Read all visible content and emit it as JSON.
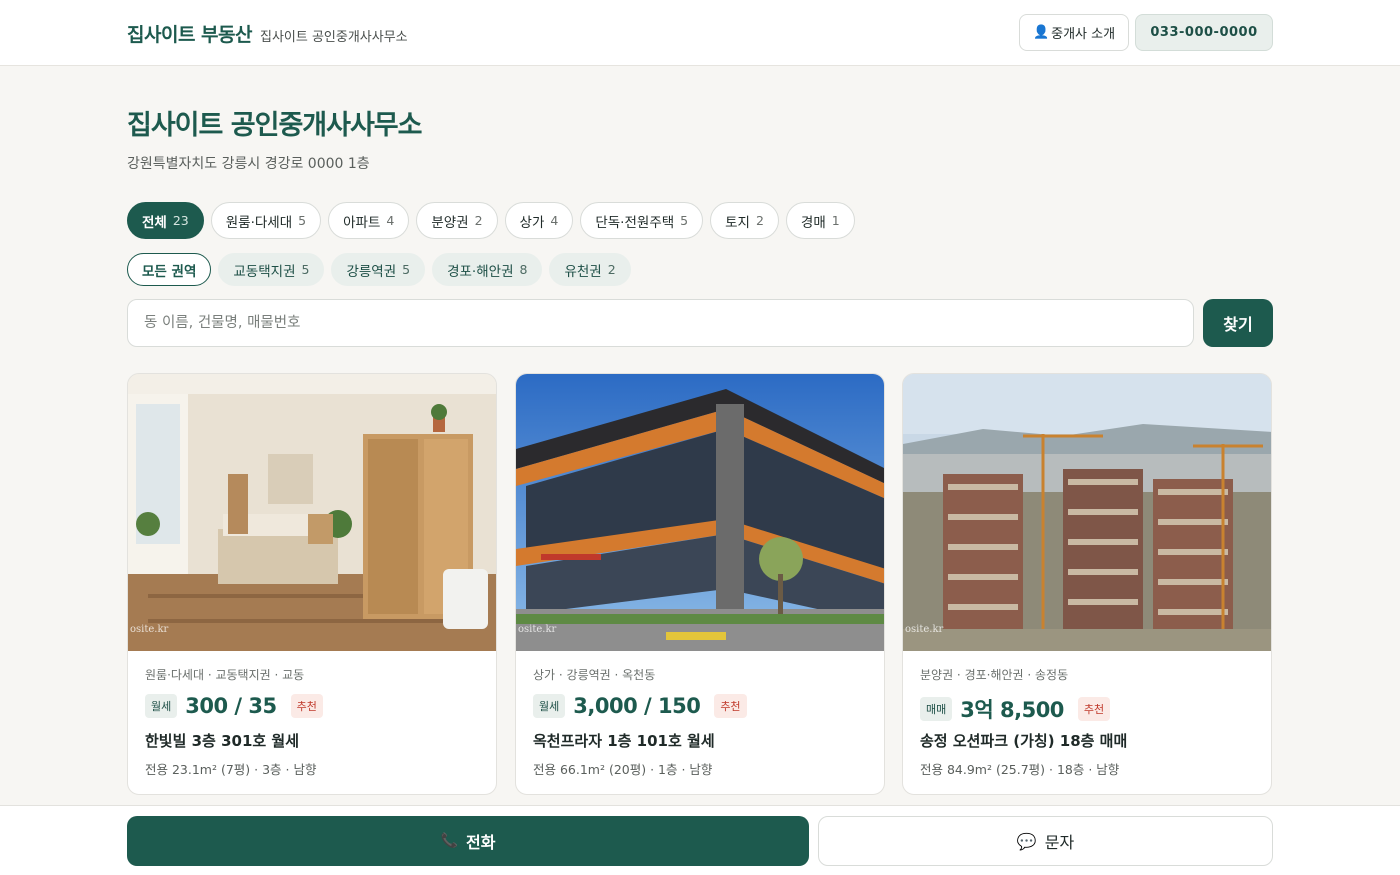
{
  "header": {
    "brand_name": "집사이트 부동산",
    "brand_sub": "집사이트 공인중개사사무소",
    "intro_button": "중개사 소개",
    "intro_icon": "person-icon",
    "phone_button": "033-000-0000"
  },
  "office": {
    "title": "집사이트 공인중개사사무소",
    "address": "강원특별자치도 강릉시 경강로 0000 1층"
  },
  "categories": [
    {
      "label": "전체",
      "count": "23",
      "active": true
    },
    {
      "label": "원룸·다세대",
      "count": "5"
    },
    {
      "label": "아파트",
      "count": "4"
    },
    {
      "label": "분양권",
      "count": "2"
    },
    {
      "label": "상가",
      "count": "4"
    },
    {
      "label": "단독·전원주택",
      "count": "5"
    },
    {
      "label": "토지",
      "count": "2"
    },
    {
      "label": "경매",
      "count": "1"
    }
  ],
  "regions": [
    {
      "label": "모든 권역",
      "count": "",
      "active": true
    },
    {
      "label": "교동택지권",
      "count": "5"
    },
    {
      "label": "강릉역권",
      "count": "5"
    },
    {
      "label": "경포·해안권",
      "count": "8"
    },
    {
      "label": "유천권",
      "count": "2"
    }
  ],
  "search": {
    "placeholder": "동 이름, 건물명, 매물번호",
    "button": "찾기"
  },
  "listings": [
    {
      "meta": "원룸·다세대 · 교동택지권 · 교동",
      "deal": "월세",
      "price": "300 / 35",
      "badge": "추천",
      "title": "한빛빌 3층 301호 월세",
      "spec": "전용 23.1m² (7평) · 3층 · 남향",
      "watermark": "osite.kr"
    },
    {
      "meta": "상가 · 강릉역권 · 옥천동",
      "deal": "월세",
      "price": "3,000 / 150",
      "badge": "추천",
      "title": "옥천프라자 1층 101호 월세",
      "spec": "전용 66.1m² (20평) · 1층 · 남향",
      "watermark": "osite.kr"
    },
    {
      "meta": "분양권 · 경포·해안권 · 송정동",
      "deal": "매매",
      "price": "3억 8,500",
      "badge": "추천",
      "title": "송정 오션파크 (가칭) 18층 매매",
      "spec": "전용 84.9m² (25.7평) · 18층 · 남향",
      "watermark": "osite.kr"
    }
  ],
  "bottom_bar": {
    "call_label": "전화",
    "call_icon": "phone-icon",
    "sms_label": "문자",
    "sms_icon": "speech-bubble-icon"
  },
  "colors": {
    "brand": "#1d5a4e",
    "accent_red": "#c0392b",
    "background": "#f7f6f3"
  }
}
